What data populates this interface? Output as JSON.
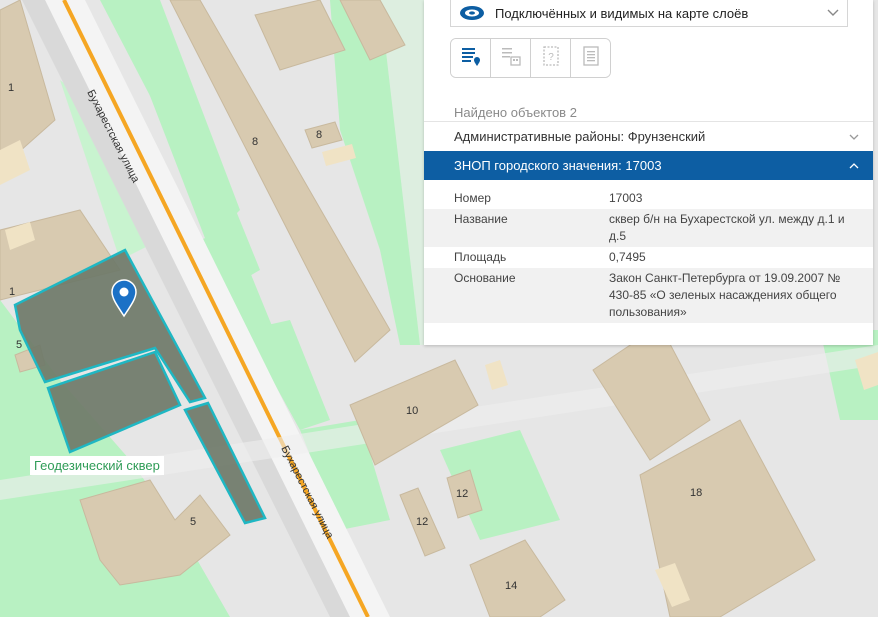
{
  "map": {
    "street_name": "Бухарестская улица",
    "park_name": "Геодезический сквер",
    "building_numbers": [
      "1",
      "1",
      "5",
      "5",
      "8",
      "8",
      "10",
      "12",
      "12",
      "14",
      "18"
    ]
  },
  "panel": {
    "layer_select_label": "Подключённых и видимых на карте слоёв",
    "toolbar_icons": [
      "list-pin-icon",
      "building-list-icon",
      "question-frame-icon",
      "document-icon"
    ],
    "found_count_text": "Найдено объектов 2",
    "accordions": [
      {
        "label": "Административные районы: Фрунзенский",
        "expanded": false
      },
      {
        "label": "ЗНОП городского значения: 17003",
        "expanded": true
      }
    ],
    "attributes": [
      {
        "key": "Номер",
        "value": "17003"
      },
      {
        "key": "Название",
        "value": "сквер б/н на Бухарестской ул. между д.1 и д.5"
      },
      {
        "key": "Площадь",
        "value": "0,7495"
      },
      {
        "key": "Основание",
        "value": "Закон Санкт-Петербурга от 19.09.2007 № 430-85 «О зеленых насаждениях общего пользования»"
      }
    ]
  },
  "colors": {
    "park_green": "#b8f1c2",
    "building": "#d8cab0",
    "road": "#f2f2f2",
    "main_road_orange": "#f5a623",
    "selection_fill": "#6f7a69",
    "selection_stroke": "#1fb7c3",
    "accent_blue": "#0d5ea3",
    "pin_blue": "#1b71c6"
  }
}
